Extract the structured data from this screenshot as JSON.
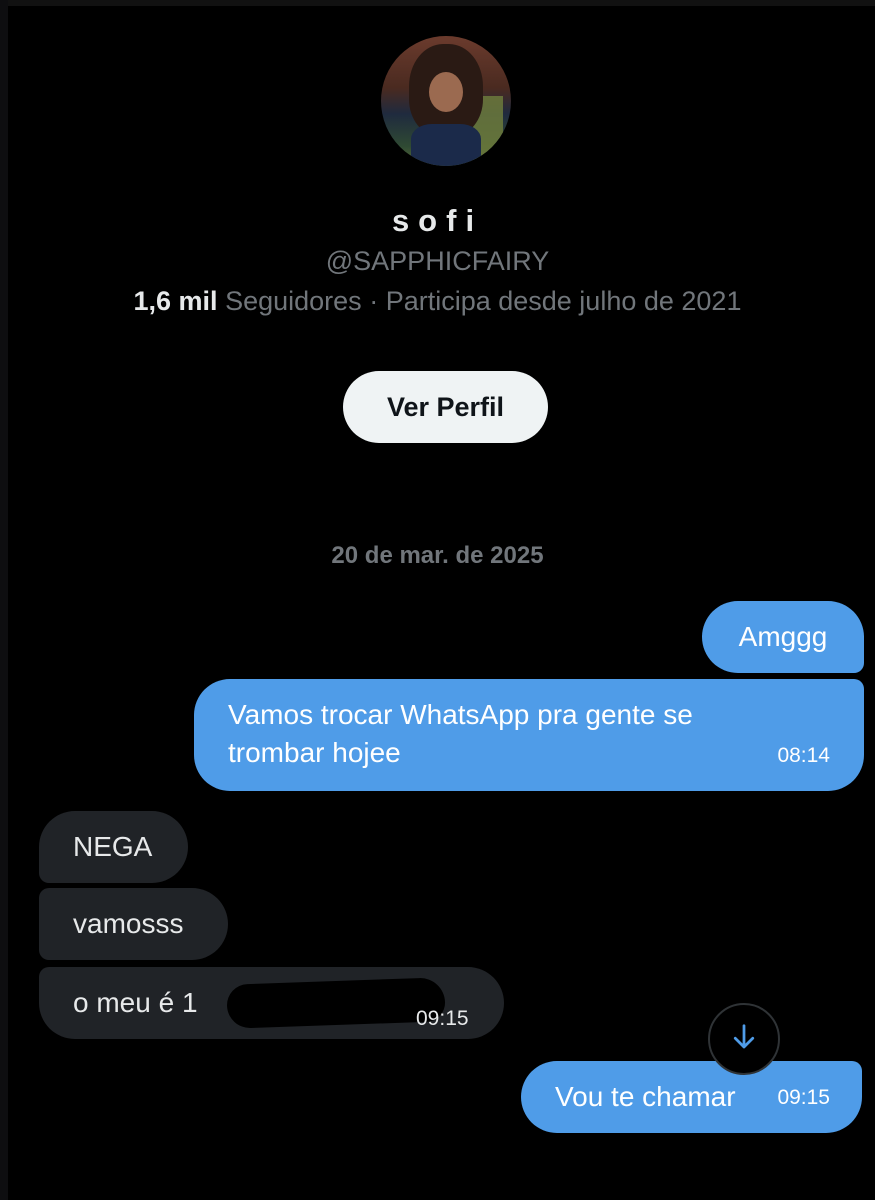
{
  "profile": {
    "name": "sofi",
    "handle": "@SAPPHICFAIRY",
    "followers_count": "1,6 mil",
    "followers_label": "Seguidores",
    "joined": "· Participa desde julho de 2021",
    "view_profile_label": "Ver Perfil"
  },
  "conversation": {
    "date": "20 de mar. de 2025",
    "messages": [
      {
        "side": "sent",
        "text": "Amggg"
      },
      {
        "side": "sent",
        "text": "Vamos trocar WhatsApp pra gente se trombar hojee",
        "time": "08:14"
      },
      {
        "side": "received",
        "text": "NEGA"
      },
      {
        "side": "received",
        "text": "vamosss"
      },
      {
        "side": "received",
        "text": "o meu é 1",
        "time": "09:15"
      },
      {
        "side": "sent",
        "text": "Vou te chamar",
        "time": "09:15"
      }
    ]
  },
  "icons": {
    "scroll_down": "arrow-down-icon"
  },
  "colors": {
    "background": "#000000",
    "sent_bubble": "#4f9ce8",
    "received_bubble": "#202327",
    "muted_text": "#71767b"
  }
}
